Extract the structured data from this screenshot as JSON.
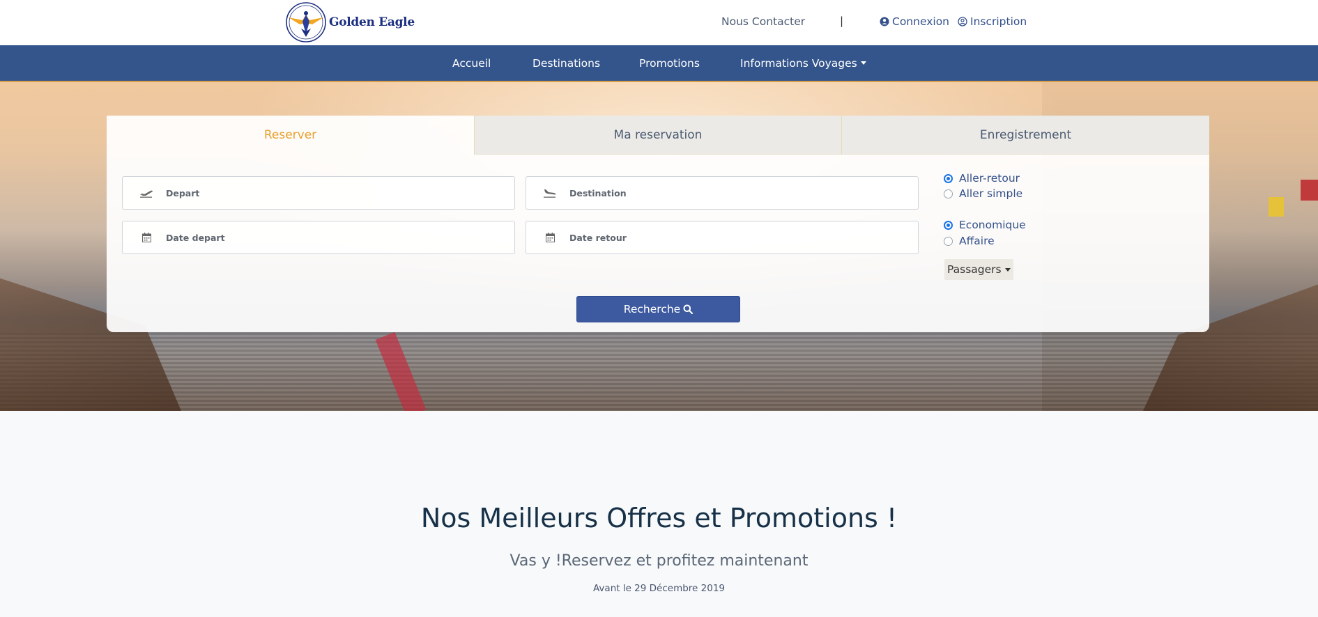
{
  "header": {
    "logo_text": "Golden Eagle",
    "contact_label": "Nous Contacter",
    "separator": "|",
    "login_label": "Connexion",
    "signup_label": "Inscription"
  },
  "nav": {
    "items": [
      {
        "label": "Accueil"
      },
      {
        "label": "Destinations"
      },
      {
        "label": "Promotions"
      },
      {
        "label": "Informations Voyages"
      }
    ]
  },
  "booking": {
    "tabs": [
      {
        "label": "Reserver",
        "active": true
      },
      {
        "label": "Ma reservation",
        "active": false
      },
      {
        "label": "Enregistrement",
        "active": false
      }
    ],
    "fields": {
      "depart_placeholder": "Depart",
      "destination_placeholder": "Destination",
      "date_depart_placeholder": "Date depart",
      "date_retour_placeholder": "Date retour"
    },
    "trip_type": [
      {
        "label": "Aller-retour",
        "selected": true
      },
      {
        "label": "Aller simple",
        "selected": false
      }
    ],
    "cabin_class": [
      {
        "label": "Economique",
        "selected": true
      },
      {
        "label": "Affaire",
        "selected": false
      }
    ],
    "passengers_label": "Passagers",
    "search_label": "Recherche"
  },
  "offers": {
    "title": "Nos Meilleurs Offres et Promotions !",
    "subtitle": "Vas y !Reservez et profitez maintenant",
    "date_note": "Avant le 29 Décembre 2019"
  },
  "colors": {
    "nav_bg": "#34558c",
    "active_tab": "#e8a02e",
    "search_button": "#3d5aa0",
    "radio_selected": "#1a73e8"
  },
  "icons": [
    "eagle-logo-icon",
    "user-circle-icon",
    "user-outline-icon",
    "plane-takeoff-icon",
    "plane-landing-icon",
    "calendar-icon",
    "search-icon",
    "caret-down-icon"
  ]
}
